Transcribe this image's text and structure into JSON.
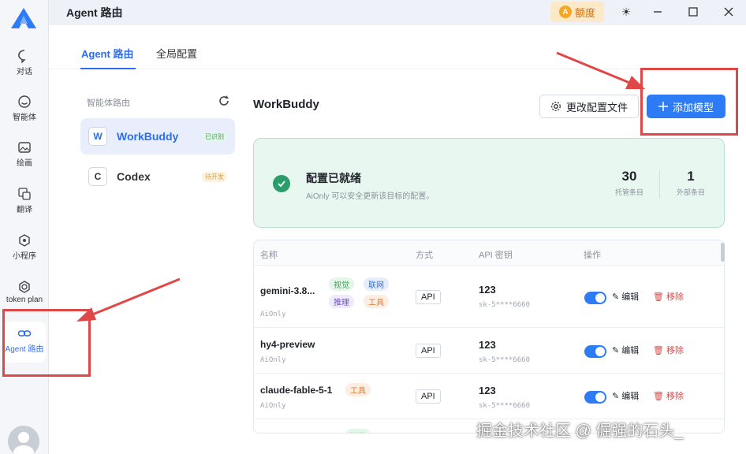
{
  "app": {
    "title": "Agent 路由",
    "quota_label": "额度",
    "quota_badge": "A"
  },
  "rail": {
    "items": [
      {
        "label": "对话",
        "icon": "chat-icon"
      },
      {
        "label": "智能体",
        "icon": "agent-icon"
      },
      {
        "label": "绘画",
        "icon": "image-icon"
      },
      {
        "label": "翻译",
        "icon": "translate-icon"
      },
      {
        "label": "小程序",
        "icon": "miniapp-icon"
      },
      {
        "label": "token plan",
        "icon": "token-icon"
      },
      {
        "label": "Agent 路由",
        "icon": "link-icon",
        "active": true
      }
    ]
  },
  "tabs": [
    {
      "label": "Agent 路由",
      "active": true
    },
    {
      "label": "全局配置"
    }
  ],
  "sidebar": {
    "title": "智能体路由",
    "agents": [
      {
        "letter": "W",
        "name": "WorkBuddy",
        "tag": "已识别",
        "selected": true
      },
      {
        "letter": "C",
        "name": "Codex",
        "tag": "待开发",
        "selected": false
      }
    ]
  },
  "detail": {
    "title": "WorkBuddy",
    "config_button": "更改配置文件",
    "add_button": "添加模型",
    "status": {
      "title": "配置已就绪",
      "subtitle": "AiOnly 可以安全更新该目标的配置。",
      "managed_count": "30",
      "managed_label": "托管条目",
      "external_count": "1",
      "external_label": "外部条目"
    },
    "table": {
      "headers": [
        "名称",
        "方式",
        "API 密钥",
        "操作"
      ],
      "rows": [
        {
          "name": "gemini-3.8...",
          "provider": "AiOnly",
          "tags": [
            "视觉",
            "联网",
            "推理",
            "工具"
          ],
          "mode": "API",
          "key": "123",
          "masked": "sk-5****6660",
          "edit": "编辑",
          "remove": "移除"
        },
        {
          "name": "hy4-preview",
          "provider": "AiOnly",
          "tags": [],
          "mode": "API",
          "key": "123",
          "masked": "sk-5****6660",
          "edit": "编辑",
          "remove": "移除"
        },
        {
          "name": "claude-fable-5-1",
          "provider": "AiOnly",
          "tags": [
            "工具"
          ],
          "mode": "API",
          "key": "123",
          "masked": "sk-5****6660",
          "edit": "编辑",
          "remove": "移除"
        },
        {
          "name": "",
          "provider": "",
          "tags": [
            "视觉"
          ],
          "mode": "",
          "key": "",
          "masked": "",
          "edit": "",
          "remove": ""
        }
      ]
    }
  },
  "watermark": "掘金技术社区 @ 倔强的石头_",
  "colors": {
    "accent": "#2d7cf6",
    "success": "#2a9d6a",
    "highlight": "#e04848",
    "quota": "#e06b00"
  }
}
